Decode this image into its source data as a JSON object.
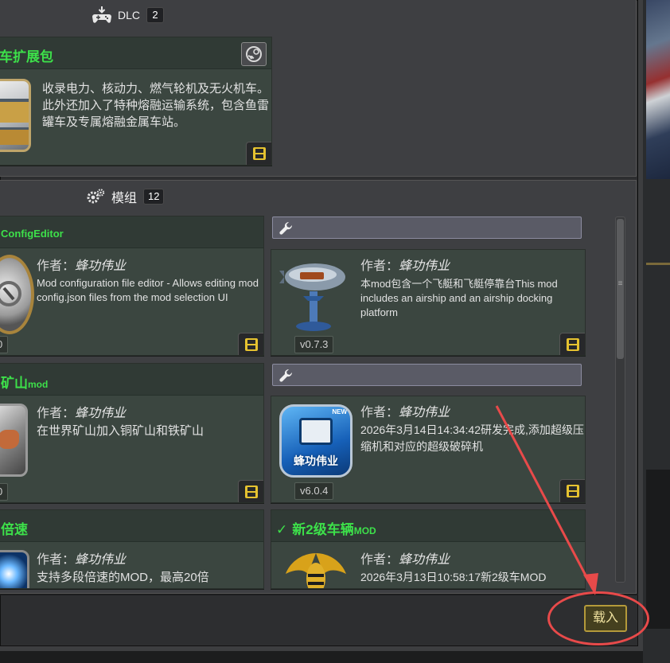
{
  "dlc_section": {
    "label": "DLC",
    "count": "2"
  },
  "dlc_card": {
    "title": "车扩展包",
    "description": "收录电力、核动力、燃气轮机及无火机车。此外还加入了特种熔融运输系统，包含鱼雷罐车及专属熔融金属车站。"
  },
  "mods_section": {
    "label": "模组",
    "count": "12"
  },
  "mods": [
    {
      "title": "ConfigEditor",
      "author_label": "作者：",
      "author": "蜂功伟业",
      "description": "Mod configuration file editor - Allows editing mod config.json files from the mod selection UI",
      "version": "0"
    },
    {
      "title": "",
      "author_label": "作者：",
      "author": "蜂功伟业",
      "description": "本mod包含一个飞艇和飞艇停靠台This mod includes an airship and an airship docking platform",
      "version": "v0.7.3"
    },
    {
      "title": "矿山",
      "title_suffix": "mod",
      "author_label": "作者：",
      "author": "蜂功伟业",
      "description": "在世界矿山加入铜矿山和铁矿山",
      "version": "0"
    },
    {
      "title": "",
      "author_label": "作者：",
      "author": "蜂功伟业",
      "description": "2026年3月14日14:34:42研发完成,添加超级压缩机和对应的超级破碎机",
      "version": "v6.0.4",
      "thumb_text": "蜂功伟业",
      "thumb_badge": "NEW"
    },
    {
      "title": "倍速",
      "author_label": "作者：",
      "author": "蜂功伟业",
      "description": "支持多段倍速的MOD，最高20倍"
    },
    {
      "title": "新2级车辆",
      "title_suffix": "MOD",
      "check": "✓",
      "author_label": "作者：",
      "author": "蜂功伟业",
      "description": "2026年3月13日10:58:17新2级车MOD"
    }
  ],
  "load_button": "载入",
  "colors": {
    "mod_title": "#3de04a",
    "save_icon": "#e5c230",
    "annotation": "#e84a4a"
  }
}
